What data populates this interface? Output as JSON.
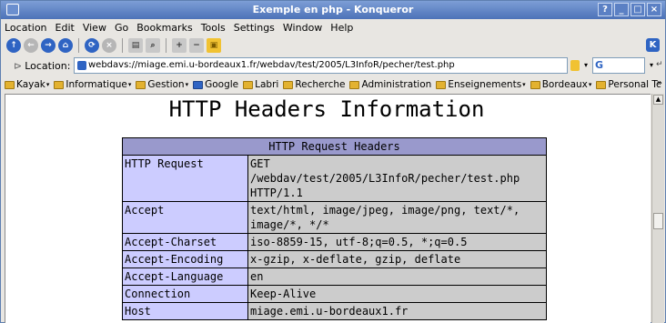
{
  "window": {
    "title": "Exemple en php - Konqueror",
    "buttons": [
      "?",
      "_",
      "□",
      "×"
    ]
  },
  "menu": [
    "Location",
    "Edit",
    "View",
    "Go",
    "Bookmarks",
    "Tools",
    "Settings",
    "Window",
    "Help"
  ],
  "location": {
    "label": "Location:",
    "url": "webdavs://miage.emi.u-bordeaux1.fr/webdav/test/2005/L3InfoR/pecher/test.php"
  },
  "bookmarks": [
    "Kayak",
    "Informatique",
    "Gestion",
    "Google",
    "Labri",
    "Recherche",
    "Administration",
    "Enseignements",
    "Bordeaux",
    "Personal Tc",
    "»"
  ],
  "page": {
    "title": "HTTP Headers Information",
    "table_title": "HTTP Request Headers",
    "rows": [
      {
        "key": "HTTP Request",
        "value": "GET /webdav/test/2005/L3InfoR/pecher/test.php HTTP/1.1"
      },
      {
        "key": "Accept",
        "value": "text/html, image/jpeg, image/png, text/*, image/*, */*"
      },
      {
        "key": "Accept-Charset",
        "value": "iso-8859-15, utf-8;q=0.5, *;q=0.5"
      },
      {
        "key": "Accept-Encoding",
        "value": "x-gzip, x-deflate, gzip, deflate"
      },
      {
        "key": "Accept-Language",
        "value": "en"
      },
      {
        "key": "Connection",
        "value": "Keep-Alive"
      },
      {
        "key": "Host",
        "value": "miage.emi.u-bordeaux1.fr"
      }
    ]
  }
}
